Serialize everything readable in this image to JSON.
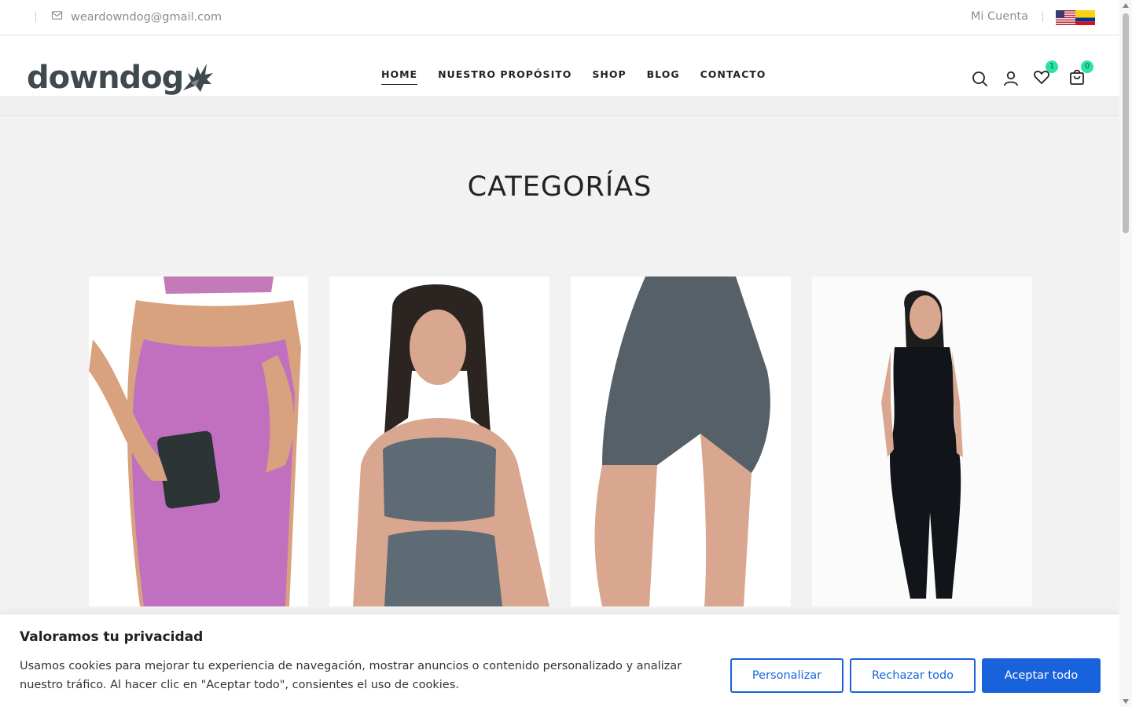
{
  "topbar": {
    "email": "weardowndog@gmail.com",
    "account_label": "Mi Cuenta"
  },
  "header": {
    "logo_text": "downdog",
    "nav": [
      {
        "label": "HOME",
        "active": true
      },
      {
        "label": "NUESTRO PROPÓSITO",
        "active": false
      },
      {
        "label": "SHOP",
        "active": false
      },
      {
        "label": "BLOG",
        "active": false
      },
      {
        "label": "CONTACTO",
        "active": false
      }
    ],
    "wishlist_count": "1",
    "cart_count": "0"
  },
  "main": {
    "title": "CATEGORÍAS"
  },
  "cookie_banner": {
    "heading": "Valoramos tu privacidad",
    "text": "Usamos cookies para mejorar tu experiencia de navegación, mostrar anuncios o contenido personalizado y analizar nuestro tráfico. Al hacer clic en \"Aceptar todo\", consientes el uso de cookies.",
    "customize_label": "Personalizar",
    "reject_label": "Rechazar todo",
    "accept_label": "Aceptar todo"
  },
  "colors": {
    "primary": "#1863dc",
    "badge": "#2be3a8",
    "logo": "#3f4a4e"
  }
}
